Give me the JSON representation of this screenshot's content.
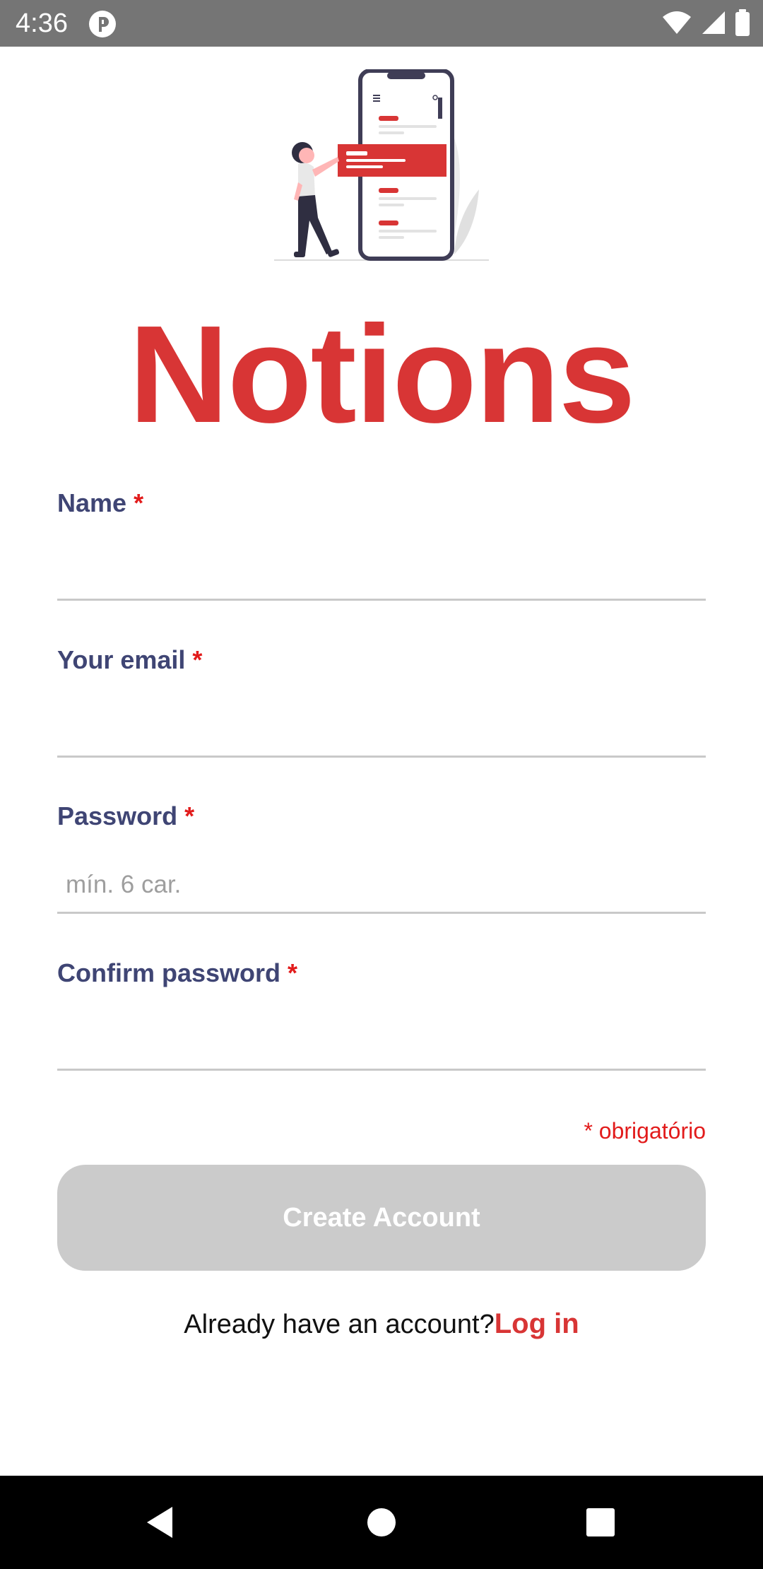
{
  "status_bar": {
    "time": "4:36",
    "icons": [
      "app-notification-icon",
      "wifi-icon",
      "cell-signal-icon",
      "battery-icon"
    ]
  },
  "app": {
    "title": "Notions",
    "title_color": "#d83535"
  },
  "form": {
    "name": {
      "label": "Name",
      "required_mark": "*",
      "value": "",
      "placeholder": ""
    },
    "email": {
      "label": "Your email",
      "required_mark": "*",
      "value": "",
      "placeholder": ""
    },
    "password": {
      "label": "Password",
      "required_mark": "*",
      "value": "",
      "placeholder": "mín. 6 car."
    },
    "confirm_password": {
      "label": "Confirm password",
      "required_mark": "*",
      "value": "",
      "placeholder": ""
    },
    "required_note": "* obrigatório"
  },
  "actions": {
    "create_account_label": "Create Account",
    "create_account_enabled": false,
    "login_prompt": "Already have an account?",
    "login_link": "Log in"
  },
  "colors": {
    "accent": "#d83535",
    "label": "#3f4574",
    "required": "#e21b1b",
    "disabled_button": "#cbcbcb"
  },
  "nav_bar": {
    "buttons": [
      "back-icon",
      "home-icon",
      "recents-icon"
    ]
  }
}
